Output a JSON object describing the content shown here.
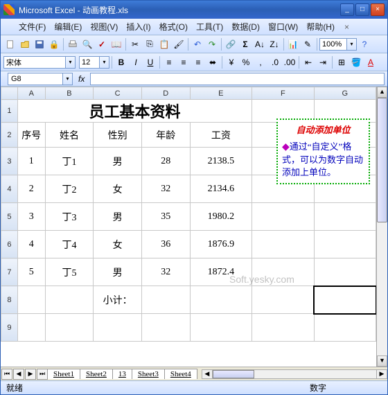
{
  "window": {
    "title": "Microsoft Excel - 动画教程.xls"
  },
  "menus": {
    "file": "文件(F)",
    "edit": "编辑(E)",
    "view": "视图(V)",
    "insert": "插入(I)",
    "format": "格式(O)",
    "tools": "工具(T)",
    "data": "数据(D)",
    "window": "窗口(W)",
    "help": "帮助(H)"
  },
  "toolbar": {
    "zoom": "100%"
  },
  "format": {
    "font": "宋体",
    "size": "12",
    "bold": "B",
    "italic": "I",
    "underline": "U"
  },
  "namebox": "G8",
  "columns": [
    "A",
    "B",
    "C",
    "D",
    "E",
    "F",
    "G"
  ],
  "sheet": {
    "title": "员工基本资料",
    "headers": {
      "num": "序号",
      "name": "姓名",
      "sex": "性别",
      "age": "年龄",
      "sal": "工资"
    },
    "rows": [
      {
        "num": "1",
        "name": "丁1",
        "sex": "男",
        "age": "28",
        "sal": "2138.5"
      },
      {
        "num": "2",
        "name": "丁2",
        "sex": "女",
        "age": "32",
        "sal": "2134.6"
      },
      {
        "num": "3",
        "name": "丁3",
        "sex": "男",
        "age": "35",
        "sal": "1980.2"
      },
      {
        "num": "4",
        "name": "丁4",
        "sex": "女",
        "age": "36",
        "sal": "1876.9"
      },
      {
        "num": "5",
        "name": "丁5",
        "sex": "男",
        "age": "32",
        "sal": "1872.4"
      }
    ],
    "subtotal": "小计："
  },
  "note": {
    "title": "自动添加单位",
    "body": "通过“自定义”格式，可以为数字自动添加上单位。"
  },
  "watermark": "Soft.yesky.com",
  "tabs": [
    "Sheet1",
    "Sheet2",
    "13",
    "Sheet3",
    "Sheet4"
  ],
  "status": {
    "left": "就绪",
    "right": "数字"
  }
}
